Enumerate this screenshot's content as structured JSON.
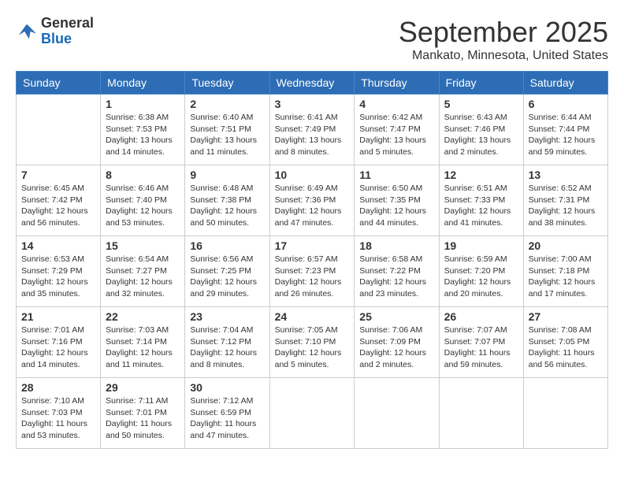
{
  "logo": {
    "general": "General",
    "blue": "Blue"
  },
  "title": "September 2025",
  "location": "Mankato, Minnesota, United States",
  "weekdays": [
    "Sunday",
    "Monday",
    "Tuesday",
    "Wednesday",
    "Thursday",
    "Friday",
    "Saturday"
  ],
  "weeks": [
    [
      {
        "day": "",
        "sunrise": "",
        "sunset": "",
        "daylight": ""
      },
      {
        "day": "1",
        "sunrise": "Sunrise: 6:38 AM",
        "sunset": "Sunset: 7:53 PM",
        "daylight": "Daylight: 13 hours and 14 minutes."
      },
      {
        "day": "2",
        "sunrise": "Sunrise: 6:40 AM",
        "sunset": "Sunset: 7:51 PM",
        "daylight": "Daylight: 13 hours and 11 minutes."
      },
      {
        "day": "3",
        "sunrise": "Sunrise: 6:41 AM",
        "sunset": "Sunset: 7:49 PM",
        "daylight": "Daylight: 13 hours and 8 minutes."
      },
      {
        "day": "4",
        "sunrise": "Sunrise: 6:42 AM",
        "sunset": "Sunset: 7:47 PM",
        "daylight": "Daylight: 13 hours and 5 minutes."
      },
      {
        "day": "5",
        "sunrise": "Sunrise: 6:43 AM",
        "sunset": "Sunset: 7:46 PM",
        "daylight": "Daylight: 13 hours and 2 minutes."
      },
      {
        "day": "6",
        "sunrise": "Sunrise: 6:44 AM",
        "sunset": "Sunset: 7:44 PM",
        "daylight": "Daylight: 12 hours and 59 minutes."
      }
    ],
    [
      {
        "day": "7",
        "sunrise": "Sunrise: 6:45 AM",
        "sunset": "Sunset: 7:42 PM",
        "daylight": "Daylight: 12 hours and 56 minutes."
      },
      {
        "day": "8",
        "sunrise": "Sunrise: 6:46 AM",
        "sunset": "Sunset: 7:40 PM",
        "daylight": "Daylight: 12 hours and 53 minutes."
      },
      {
        "day": "9",
        "sunrise": "Sunrise: 6:48 AM",
        "sunset": "Sunset: 7:38 PM",
        "daylight": "Daylight: 12 hours and 50 minutes."
      },
      {
        "day": "10",
        "sunrise": "Sunrise: 6:49 AM",
        "sunset": "Sunset: 7:36 PM",
        "daylight": "Daylight: 12 hours and 47 minutes."
      },
      {
        "day": "11",
        "sunrise": "Sunrise: 6:50 AM",
        "sunset": "Sunset: 7:35 PM",
        "daylight": "Daylight: 12 hours and 44 minutes."
      },
      {
        "day": "12",
        "sunrise": "Sunrise: 6:51 AM",
        "sunset": "Sunset: 7:33 PM",
        "daylight": "Daylight: 12 hours and 41 minutes."
      },
      {
        "day": "13",
        "sunrise": "Sunrise: 6:52 AM",
        "sunset": "Sunset: 7:31 PM",
        "daylight": "Daylight: 12 hours and 38 minutes."
      }
    ],
    [
      {
        "day": "14",
        "sunrise": "Sunrise: 6:53 AM",
        "sunset": "Sunset: 7:29 PM",
        "daylight": "Daylight: 12 hours and 35 minutes."
      },
      {
        "day": "15",
        "sunrise": "Sunrise: 6:54 AM",
        "sunset": "Sunset: 7:27 PM",
        "daylight": "Daylight: 12 hours and 32 minutes."
      },
      {
        "day": "16",
        "sunrise": "Sunrise: 6:56 AM",
        "sunset": "Sunset: 7:25 PM",
        "daylight": "Daylight: 12 hours and 29 minutes."
      },
      {
        "day": "17",
        "sunrise": "Sunrise: 6:57 AM",
        "sunset": "Sunset: 7:23 PM",
        "daylight": "Daylight: 12 hours and 26 minutes."
      },
      {
        "day": "18",
        "sunrise": "Sunrise: 6:58 AM",
        "sunset": "Sunset: 7:22 PM",
        "daylight": "Daylight: 12 hours and 23 minutes."
      },
      {
        "day": "19",
        "sunrise": "Sunrise: 6:59 AM",
        "sunset": "Sunset: 7:20 PM",
        "daylight": "Daylight: 12 hours and 20 minutes."
      },
      {
        "day": "20",
        "sunrise": "Sunrise: 7:00 AM",
        "sunset": "Sunset: 7:18 PM",
        "daylight": "Daylight: 12 hours and 17 minutes."
      }
    ],
    [
      {
        "day": "21",
        "sunrise": "Sunrise: 7:01 AM",
        "sunset": "Sunset: 7:16 PM",
        "daylight": "Daylight: 12 hours and 14 minutes."
      },
      {
        "day": "22",
        "sunrise": "Sunrise: 7:03 AM",
        "sunset": "Sunset: 7:14 PM",
        "daylight": "Daylight: 12 hours and 11 minutes."
      },
      {
        "day": "23",
        "sunrise": "Sunrise: 7:04 AM",
        "sunset": "Sunset: 7:12 PM",
        "daylight": "Daylight: 12 hours and 8 minutes."
      },
      {
        "day": "24",
        "sunrise": "Sunrise: 7:05 AM",
        "sunset": "Sunset: 7:10 PM",
        "daylight": "Daylight: 12 hours and 5 minutes."
      },
      {
        "day": "25",
        "sunrise": "Sunrise: 7:06 AM",
        "sunset": "Sunset: 7:09 PM",
        "daylight": "Daylight: 12 hours and 2 minutes."
      },
      {
        "day": "26",
        "sunrise": "Sunrise: 7:07 AM",
        "sunset": "Sunset: 7:07 PM",
        "daylight": "Daylight: 11 hours and 59 minutes."
      },
      {
        "day": "27",
        "sunrise": "Sunrise: 7:08 AM",
        "sunset": "Sunset: 7:05 PM",
        "daylight": "Daylight: 11 hours and 56 minutes."
      }
    ],
    [
      {
        "day": "28",
        "sunrise": "Sunrise: 7:10 AM",
        "sunset": "Sunset: 7:03 PM",
        "daylight": "Daylight: 11 hours and 53 minutes."
      },
      {
        "day": "29",
        "sunrise": "Sunrise: 7:11 AM",
        "sunset": "Sunset: 7:01 PM",
        "daylight": "Daylight: 11 hours and 50 minutes."
      },
      {
        "day": "30",
        "sunrise": "Sunrise: 7:12 AM",
        "sunset": "Sunset: 6:59 PM",
        "daylight": "Daylight: 11 hours and 47 minutes."
      },
      {
        "day": "",
        "sunrise": "",
        "sunset": "",
        "daylight": ""
      },
      {
        "day": "",
        "sunrise": "",
        "sunset": "",
        "daylight": ""
      },
      {
        "day": "",
        "sunrise": "",
        "sunset": "",
        "daylight": ""
      },
      {
        "day": "",
        "sunrise": "",
        "sunset": "",
        "daylight": ""
      }
    ]
  ]
}
